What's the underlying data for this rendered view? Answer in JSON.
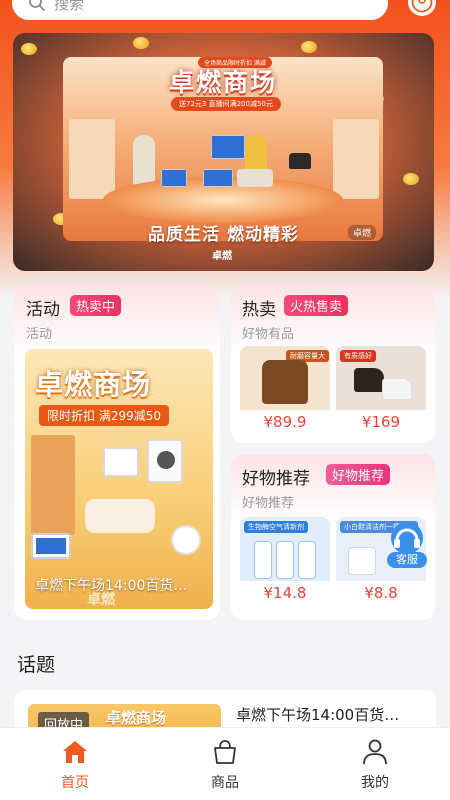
{
  "search": {
    "placeholder": "搜索"
  },
  "banner": {
    "top_tag": "全场商品限时折扣 满减",
    "title": "卓燃商场",
    "subtitle": "送72元3 直播间满200减50元",
    "slogan": "品质生活 燃动精彩",
    "corner_logo": "卓燃",
    "bottom_logo": "卓燃"
  },
  "activity_card": {
    "title": "活动",
    "tag": "热卖中",
    "subtitle": "活动",
    "promo_title": "卓燃商场",
    "promo_badge": "限时折扣 满299减50",
    "promo_caption": "卓燃下午场14:00百货…",
    "promo_logo": "卓燃"
  },
  "hot_card": {
    "title": "热卖",
    "tag": "火热售卖",
    "subtitle": "好物有品",
    "products": [
      {
        "label": "耐磨容量大",
        "price": "¥89.9"
      },
      {
        "label": "有质感好",
        "price": "¥169"
      }
    ]
  },
  "recommend_card": {
    "title": "好物推荐",
    "tag": "好物推荐",
    "subtitle": "好物推荐",
    "products": [
      {
        "label": "生物酶空气清新剂",
        "price": "¥14.8"
      },
      {
        "label": "小白鞋清洁剂一擦即净",
        "price": "¥8.8",
        "service_label": "客服"
      }
    ]
  },
  "topics": {
    "title": "话题",
    "items": [
      {
        "status": "回放中",
        "thumb_title": "卓燃商场",
        "text": "卓燃下午场14:00百货…"
      }
    ]
  },
  "tabbar": {
    "items": [
      {
        "label": "首页",
        "icon": "home-icon",
        "active": true
      },
      {
        "label": "商品",
        "icon": "shopping-bag-icon",
        "active": false
      },
      {
        "label": "我的",
        "icon": "user-icon",
        "active": false
      }
    ]
  },
  "colors": {
    "accent": "#f05a1e",
    "price": "#f0413a",
    "tag": "#e8325c"
  }
}
